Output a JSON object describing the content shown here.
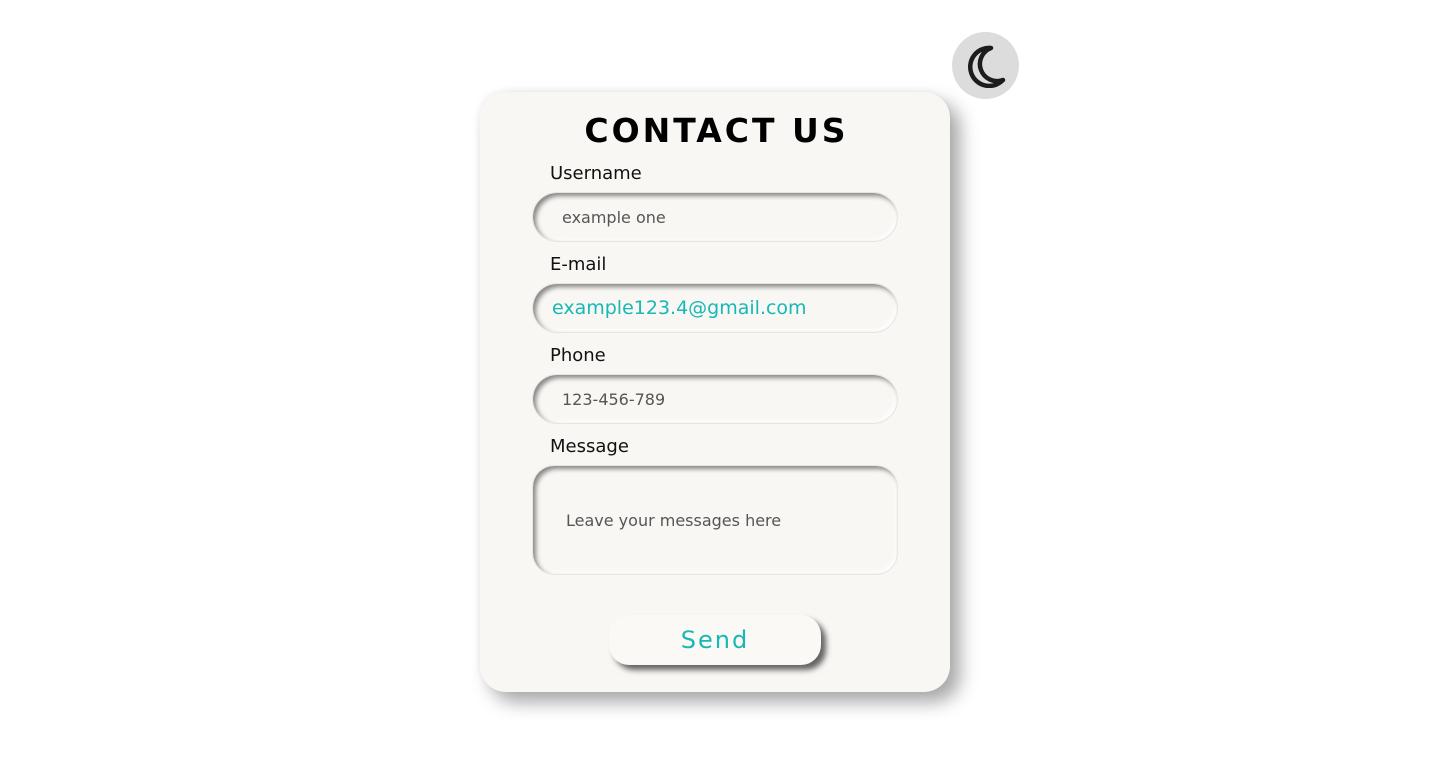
{
  "theme_toggle": {
    "icon": "moon-icon"
  },
  "form": {
    "title": "CONTACT US",
    "fields": {
      "username": {
        "label": "Username",
        "placeholder": "example one"
      },
      "email": {
        "label": "E-mail",
        "value": "example123.4@gmail.com"
      },
      "phone": {
        "label": "Phone",
        "placeholder": "123-456-789"
      },
      "message": {
        "label": "Message",
        "placeholder": "Leave your messages here"
      }
    },
    "submit_label": "Send"
  },
  "colors": {
    "accent": "#17b8b5",
    "card_bg": "#f8f7f4",
    "toggle_bg": "#dcdcdc"
  }
}
